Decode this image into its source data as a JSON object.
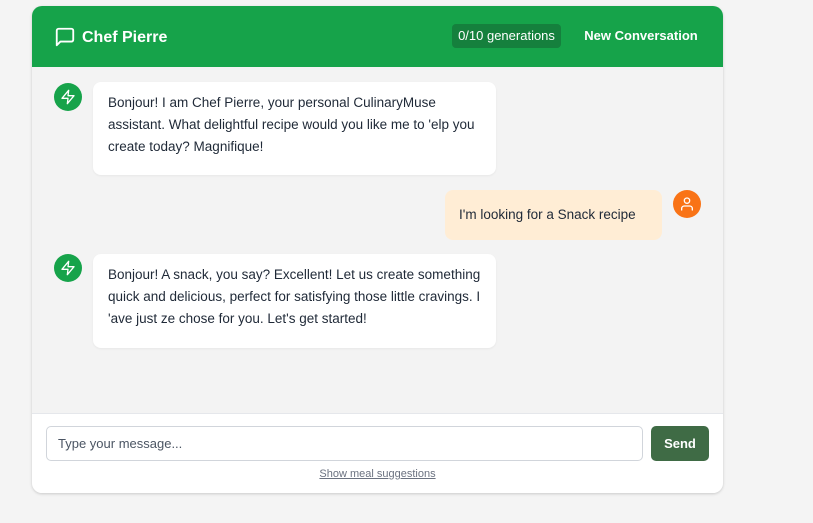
{
  "header": {
    "title": "Chef Pierre",
    "generations_badge": "0/10 generations",
    "new_conversation_label": "New Conversation",
    "icon": "message-square-icon"
  },
  "messages": [
    {
      "role": "assistant",
      "avatar_icon": "zap-icon",
      "text": "Bonjour! I am Chef Pierre, your personal CulinaryMuse assistant. What delightful recipe would you like me to 'elp you create today? Magnifique!"
    },
    {
      "role": "user",
      "avatar_icon": "user-icon",
      "text": "I'm looking for a Snack recipe"
    },
    {
      "role": "assistant",
      "avatar_icon": "zap-icon",
      "text": "Bonjour! A snack, you say? Excellent! Let us create something quick and delicious, perfect for satisfying those little cravings. I 'ave just ze chose for you. Let's get started!"
    }
  ],
  "composer": {
    "placeholder": "Type your message...",
    "value": "",
    "send_label": "Send",
    "suggestions_link": "Show meal suggestions"
  },
  "colors": {
    "brand_green": "#16a34a",
    "badge_green": "#15803d",
    "send_button": "#3f6b45",
    "user_avatar": "#f97316",
    "user_bubble": "#ffedd5"
  }
}
